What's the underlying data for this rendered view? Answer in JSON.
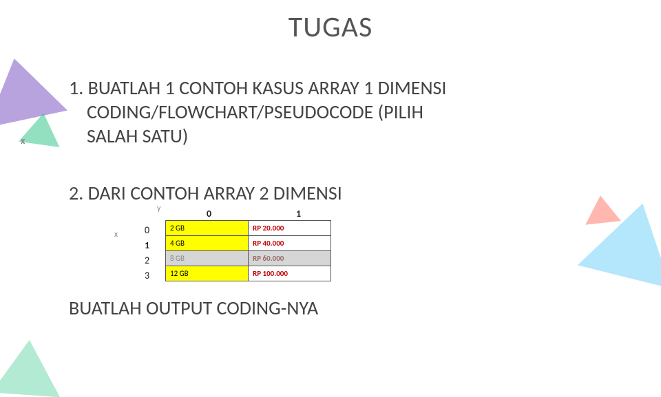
{
  "title": "TUGAS",
  "item1": {
    "line1": "1. BUATLAH 1 CONTOH KASUS ARRAY 1 DIMENSI",
    "line2": "CODING/FLOWCHART/PSEUDOCODE (PILIH",
    "line3": "SALAH SATU)"
  },
  "item2": {
    "head": "2. DARI CONTOH ARRAY 2 DIMENSI"
  },
  "table": {
    "axis_y": "y",
    "axis_x": "x",
    "col_headers": [
      "0",
      "1"
    ],
    "row_headers": [
      "0",
      "1",
      "2",
      "3"
    ],
    "rows": [
      {
        "capacity": "2 GB",
        "price": "RP 20.000"
      },
      {
        "capacity": "4 GB",
        "price": "RP 40.000"
      },
      {
        "capacity": "8 GB",
        "price": "RP 60.000"
      },
      {
        "capacity": "12 GB",
        "price": "RP 100.000"
      }
    ]
  },
  "footer": "BUATLAH OUTPUT CODING-NYA",
  "deco_x": "x"
}
